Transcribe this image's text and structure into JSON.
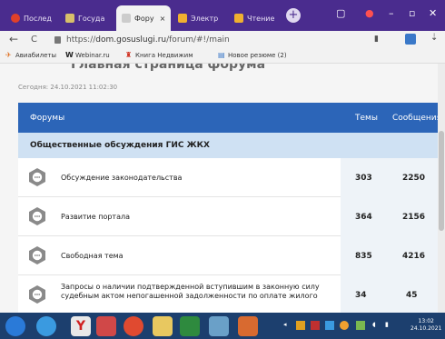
{
  "browser": {
    "tabs": [
      {
        "label": "Послед",
        "color": "#e0402a"
      },
      {
        "label": "Госуда",
        "color": "#d8c06a"
      },
      {
        "label": "Фору",
        "color": "#cccccc"
      },
      {
        "label": "Электр",
        "color": "#f0b030"
      },
      {
        "label": "Чтение",
        "color": "#f0b030"
      }
    ],
    "new_tab": "+",
    "tab_close": "×",
    "window_buttons": [
      "–",
      "▫",
      "✕"
    ],
    "back": "←",
    "reload": "C",
    "url_prefix": "https://",
    "url_host": "dom.gosuslugi.ru",
    "url_path": "/forum/#!/main",
    "bookmarks": [
      {
        "label": "Авиабилеты",
        "icon": "plane-icon",
        "color": "#e07020",
        "glyph": "✈"
      },
      {
        "label": "Webinar.ru",
        "icon": "webinar-icon",
        "color": "#222222",
        "glyph": "W"
      },
      {
        "label": "Книга Недвижим",
        "icon": "book-icon",
        "color": "#d03020",
        "glyph": "♜"
      },
      {
        "label": "Новое резюме (2)",
        "icon": "document-icon",
        "color": "#3a78c8",
        "glyph": "▤"
      }
    ]
  },
  "page": {
    "title": "Главная страница форума",
    "today": "Сегодня: 24.10.2021 11:02:30",
    "table": {
      "headers": {
        "forums": "Форумы",
        "topics": "Темы",
        "messages": "Сообщения"
      },
      "section": "Общественные обсуждения ГИС ЖКХ",
      "rows": [
        {
          "title": "Обсуждение законодательства",
          "topics": "303",
          "messages": "2250"
        },
        {
          "title": "Развитие портала",
          "topics": "364",
          "messages": "2156"
        },
        {
          "title": "Свободная тема",
          "topics": "835",
          "messages": "4216"
        },
        {
          "title": "Запросы о наличии подтвержденной вступившим в законную силу судебным актом непогашенной задолженности по оплате жилого",
          "topics": "34",
          "messages": "45"
        }
      ]
    }
  },
  "taskbar": {
    "time": "13:02",
    "date": "24.10.2021",
    "apps": [
      {
        "name": "start",
        "color": "#2a7ad8"
      },
      {
        "name": "orb",
        "color": "#3a9ae0"
      },
      {
        "name": "yandex",
        "color": "#e8e8e8"
      },
      {
        "name": "mail",
        "color": "#d04848"
      },
      {
        "name": "chrome",
        "color": "#e04a30"
      },
      {
        "name": "folder",
        "color": "#e8c860"
      },
      {
        "name": "excel",
        "color": "#2e8a3e"
      },
      {
        "name": "calculator",
        "color": "#6aa0c8"
      },
      {
        "name": "media",
        "color": "#d86a30"
      }
    ]
  }
}
